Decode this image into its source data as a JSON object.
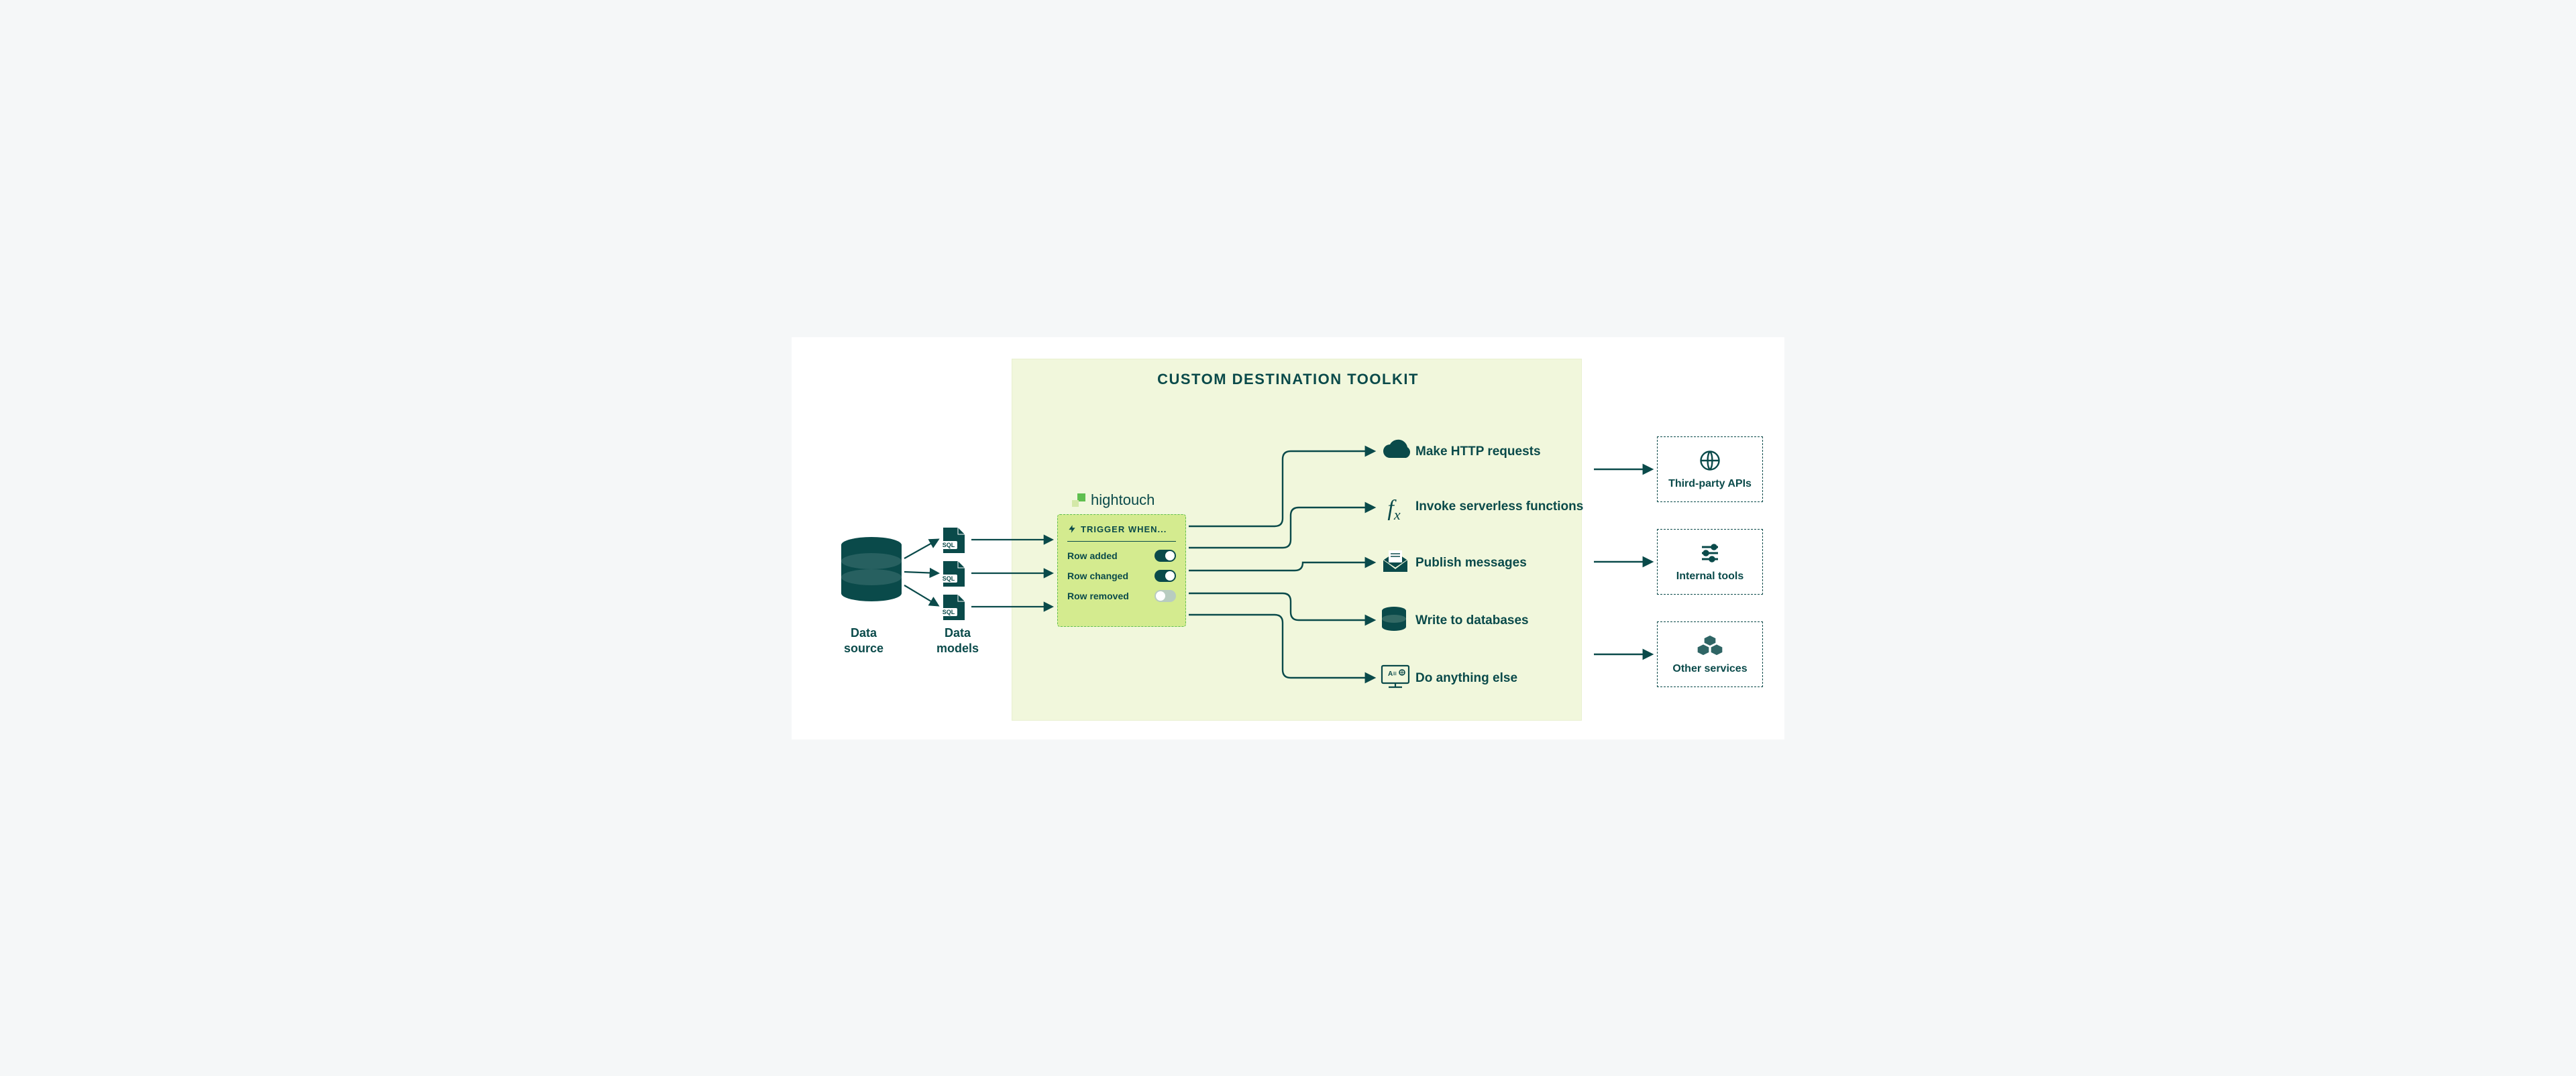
{
  "colors": {
    "teal": "#0a4a4a",
    "lime_bg": "#f1f7dc",
    "lime_panel": "#d4eb8f",
    "green": "#5fbf4f"
  },
  "toolkit": {
    "title": "CUSTOM DESTINATION TOOLKIT"
  },
  "brand": {
    "name": "hightouch"
  },
  "source": {
    "data_source": "Data\nsource",
    "data_models": "Data\nmodels"
  },
  "sql_tag": "SQL",
  "trigger": {
    "header": "TRIGGER WHEN...",
    "rows": [
      {
        "label": "Row added",
        "on": true
      },
      {
        "label": "Row changed",
        "on": true
      },
      {
        "label": "Row removed",
        "on": false
      }
    ]
  },
  "actions": [
    {
      "label": "Make HTTP requests",
      "icon": "cloud-icon"
    },
    {
      "label": "Invoke serverless functions",
      "icon": "fx-icon"
    },
    {
      "label": "Publish messages",
      "icon": "envelope-icon"
    },
    {
      "label": "Write to databases",
      "icon": "database-small-icon"
    },
    {
      "label": "Do anything else",
      "icon": "monitor-icon"
    }
  ],
  "destinations": [
    {
      "label": "Third-party APIs",
      "icon": "globe-icon"
    },
    {
      "label": "Internal tools",
      "icon": "sliders-icon"
    },
    {
      "label": "Other services",
      "icon": "cubes-icon"
    }
  ]
}
